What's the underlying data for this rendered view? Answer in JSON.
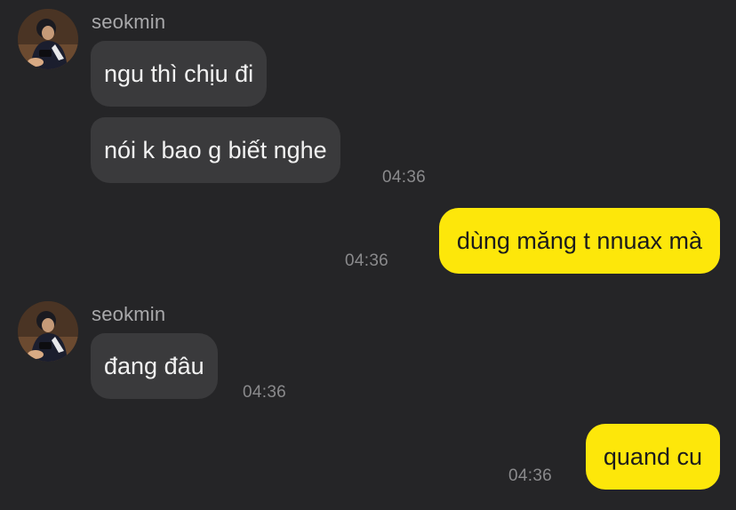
{
  "conversation": {
    "group1": {
      "sender": "seokmin",
      "messages": [
        {
          "text": "ngu thì chịu đi"
        },
        {
          "text": "nói k bao g biết nghe",
          "time": "04:36"
        }
      ]
    },
    "outgoing1": {
      "text": "dùng măng t nnuax mà",
      "time": "04:36"
    },
    "group2": {
      "sender": "seokmin",
      "messages": [
        {
          "text": "đang đâu",
          "time": "04:36"
        }
      ]
    },
    "outgoing2": {
      "text": "quand cu",
      "time": "04:36"
    }
  },
  "colors": {
    "background": "#252527",
    "incoming_bubble": "#3a3a3c",
    "outgoing_bubble": "#fde70a",
    "sender_text": "#a9a9ab",
    "timestamp_text": "#8a8a8c"
  }
}
